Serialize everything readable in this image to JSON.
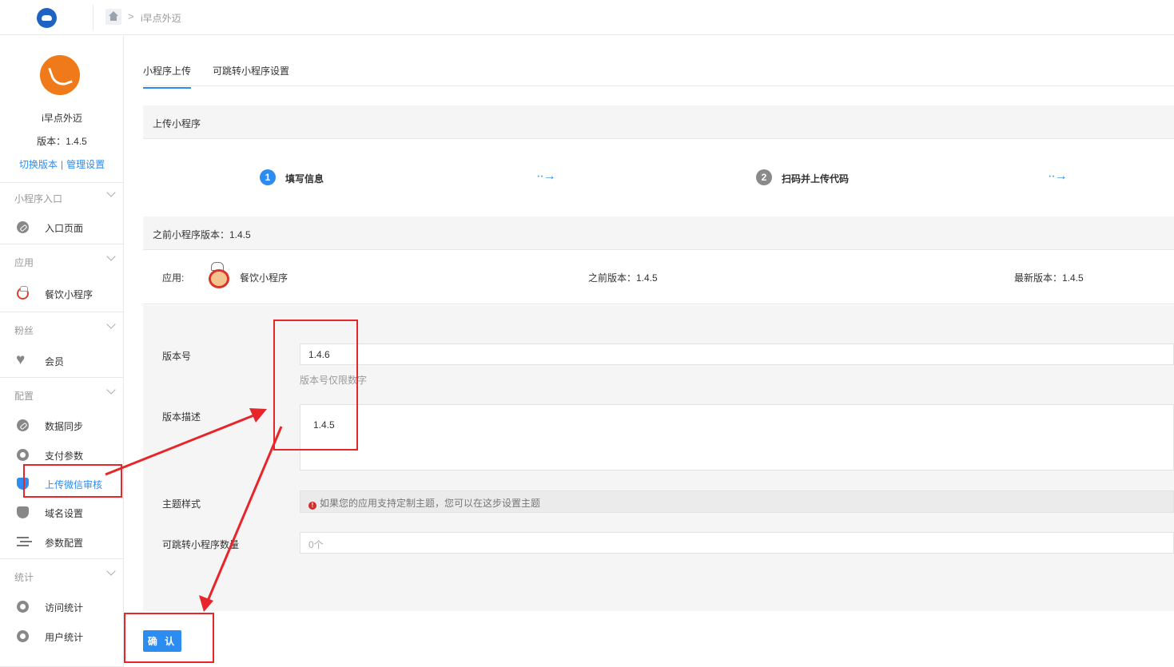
{
  "breadcrumb": {
    "current": "i早点外迈"
  },
  "sidebar": {
    "app_name": "i早点外迈",
    "version_text": "版本：1.4.5",
    "switch_version": "切换版本",
    "link_divider": "|",
    "manage_settings": "管理设置",
    "groups": [
      {
        "title": "小程序入口",
        "items": [
          {
            "label": "入口页面",
            "icon": "link-icon"
          }
        ]
      },
      {
        "title": "应用",
        "items": [
          {
            "label": "餐饮小程序",
            "icon": "chef-icon"
          }
        ]
      },
      {
        "title": "粉丝",
        "items": [
          {
            "label": "会员",
            "icon": "heart-icon"
          }
        ]
      },
      {
        "title": "配置",
        "items": [
          {
            "label": "数据同步",
            "icon": "link-icon"
          },
          {
            "label": "支付参数",
            "icon": "gear-icon"
          },
          {
            "label": "上传微信审核",
            "icon": "shield-icon",
            "active": true
          },
          {
            "label": "域名设置",
            "icon": "shield-icon"
          },
          {
            "label": "参数配置",
            "icon": "list-icon"
          }
        ]
      },
      {
        "title": "统计",
        "items": [
          {
            "label": "访问统计",
            "icon": "chart-icon"
          },
          {
            "label": "用户统计",
            "icon": "chart-icon"
          }
        ]
      }
    ]
  },
  "tabs": [
    {
      "label": "小程序上传",
      "active": true
    },
    {
      "label": "可跳转小程序设置",
      "active": false
    }
  ],
  "upload_panel": {
    "title": "上传小程序"
  },
  "steps": [
    {
      "num": "1",
      "label": "填写信息",
      "color": "#2d8cf0"
    },
    {
      "num": "2",
      "label": "扫码并上传代码",
      "color": "#8a8a8a"
    }
  ],
  "step_arrow": "··→",
  "previous_panel": {
    "title": "之前小程序版本：1.4.5"
  },
  "app_row": {
    "app_label": "应用:",
    "app_name": "餐饮小程序",
    "previous_version": "之前版本：1.4.5",
    "latest_version": "最新版本：1.4.5"
  },
  "form": {
    "version_label": "版本号",
    "version_value": "1.4.6",
    "version_hint": "版本号仅限数字",
    "desc_label": "版本描述",
    "desc_value": "1.4.5",
    "theme_label": "主题样式",
    "theme_alert_icon": "!",
    "theme_alert": "如果您的应用支持定制主题，您可以在这步设置主题",
    "jump_label": "可跳转小程序数量",
    "jump_value": "0个"
  },
  "confirm_button": "确 认",
  "colors": {
    "accent": "#2d8cf0",
    "annotation": "#e6262b",
    "logo": "#1e63c4",
    "app_logo": "#f07a1a"
  }
}
